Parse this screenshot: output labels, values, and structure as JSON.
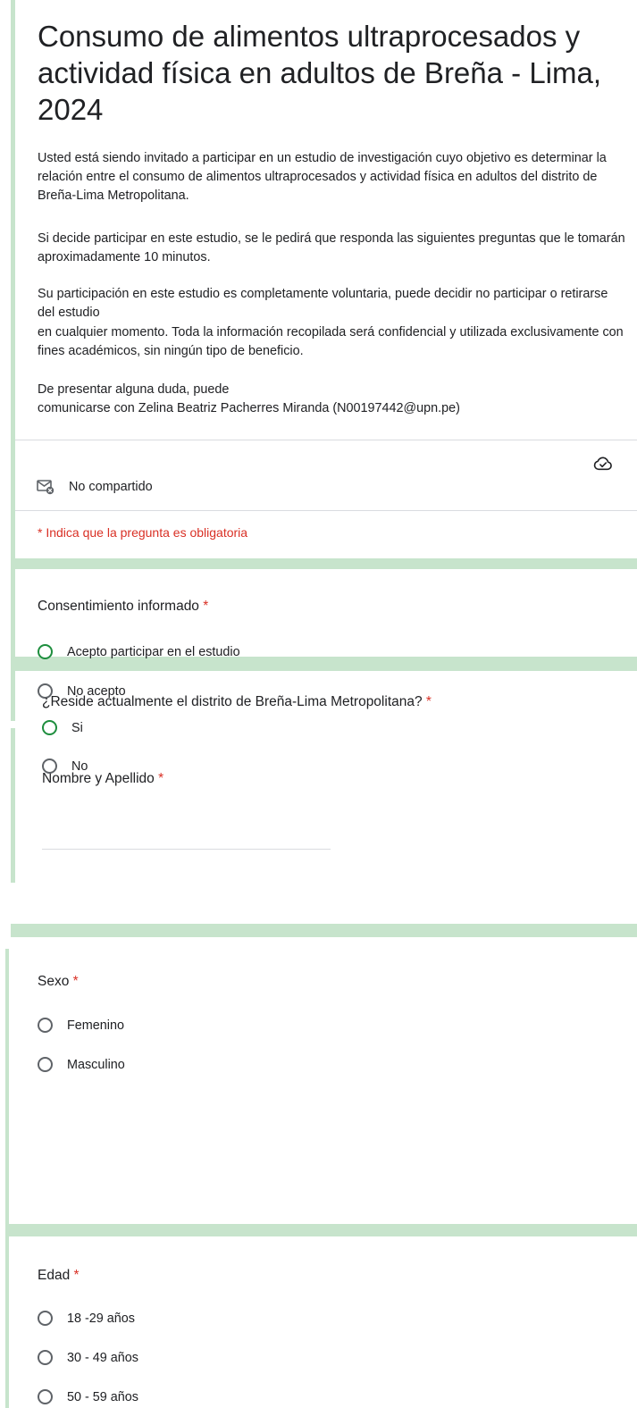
{
  "form": {
    "title": "Consumo de alimentos ultraprocesados y actividad física en adultos de Breña - Lima, 2024",
    "description": [
      "Usted está siendo invitado a participar en un estudio de investigación cuyo objetivo es determinar la relación entre el consumo de alimentos ultraprocesados y actividad física en adultos del distrito de Breña-Lima Metropolitana.",
      "Si decide participar en este estudio, se le pedirá que responda las siguientes preguntas que le tomarán aproximadamente 10 minutos.",
      "Su participación en este estudio es completamente voluntaria, puede decidir no participar o retirarse del estudio",
      "en cualquier momento. Toda la información recopilada será confidencial y utilizada exclusivamente con fines académicos, sin ningún tipo de beneficio.",
      "De presentar alguna duda, puede",
      "comunicarse con Zelina Beatriz Pacherres Miranda (N00197442@upn.pe)"
    ],
    "email_status": "No compartido",
    "required_notice": "* Indica que la pregunta es obligatoria",
    "icons": {
      "cloud": "cloud-done-icon",
      "mail": "mail-not-shared-icon"
    },
    "colors": {
      "accent": "#1e8e3e",
      "frame": "#c7e4cc",
      "required": "#d93025"
    }
  },
  "questions": {
    "consent": {
      "title": "Consentimiento informado",
      "required_mark": "*",
      "options": [
        "Acepto participar en el estudio",
        "No acepto"
      ]
    },
    "name": {
      "title": "Nombre y Apellido",
      "required_mark": "*",
      "value": ""
    },
    "residence": {
      "title": "¿Reside actualmente el distrito de Breña-Lima Metropolitana?",
      "required_mark": "*",
      "options": [
        "Si",
        "No"
      ]
    },
    "sex": {
      "title": "Sexo",
      "required_mark": "*",
      "options": [
        "Femenino",
        "Masculino"
      ]
    },
    "age": {
      "title": "Edad",
      "required_mark": "*",
      "options": [
        "18 -29 años",
        "30 - 49 años",
        "50 - 59 años"
      ]
    }
  }
}
